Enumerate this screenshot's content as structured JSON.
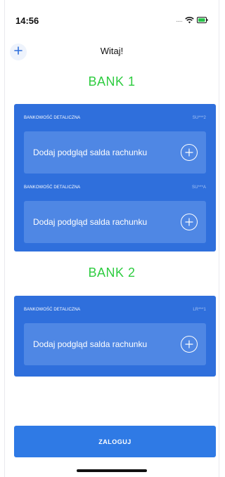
{
  "status_bar": {
    "time": "14:56",
    "signal": ".....",
    "wifi_icon": "wifi-icon",
    "battery_icon": "battery-icon"
  },
  "header": {
    "title": "Witaj!",
    "add_icon": "plus-icon"
  },
  "banks": [
    {
      "title": "BANK 1",
      "accounts": [
        {
          "type": "BANKOWOŚĆ DETALICZNA",
          "code": "SU***2",
          "action": "Dodaj podgląd salda rachunku"
        },
        {
          "type": "BANKOWOŚĆ DETALICZNA",
          "code": "SU***A",
          "action": "Dodaj podgląd salda rachunku"
        }
      ]
    },
    {
      "title": "BANK 2",
      "accounts": [
        {
          "type": "BANKOWOŚĆ DETALICZNA",
          "code": "LR***1",
          "action": "Dodaj podgląd salda rachunku"
        }
      ]
    }
  ],
  "footer": {
    "login_label": "ZALOGUJ"
  },
  "colors": {
    "bank_title": "#2ecc40",
    "card": "#2f6fdc",
    "card_inner": "#4f87e4",
    "button": "#2f7ae5"
  }
}
